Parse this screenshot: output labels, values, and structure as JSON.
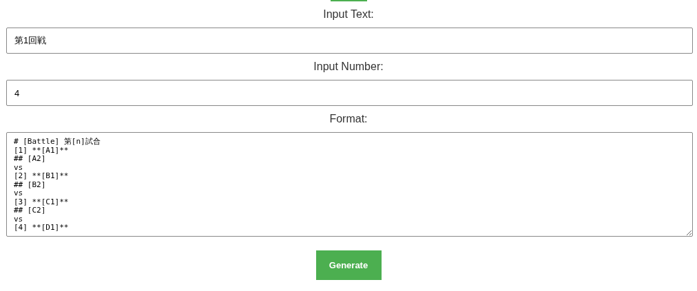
{
  "fields": [
    {
      "label": "Input Text:",
      "value": "第1回戦"
    },
    {
      "label": "Input Number:",
      "value": "4"
    }
  ],
  "format": {
    "label": "Format:",
    "lines": [
      "# [Battle] 第[n]試合",
      "[1] **[A1]**",
      "## [A2]",
      "vs",
      "[2] **[B1]**",
      "## [B2]",
      "vs",
      "[3] **[C1]**",
      "## [C2]",
      "vs",
      "[4] **[D1]**"
    ]
  },
  "button": {
    "label": "Generate"
  }
}
